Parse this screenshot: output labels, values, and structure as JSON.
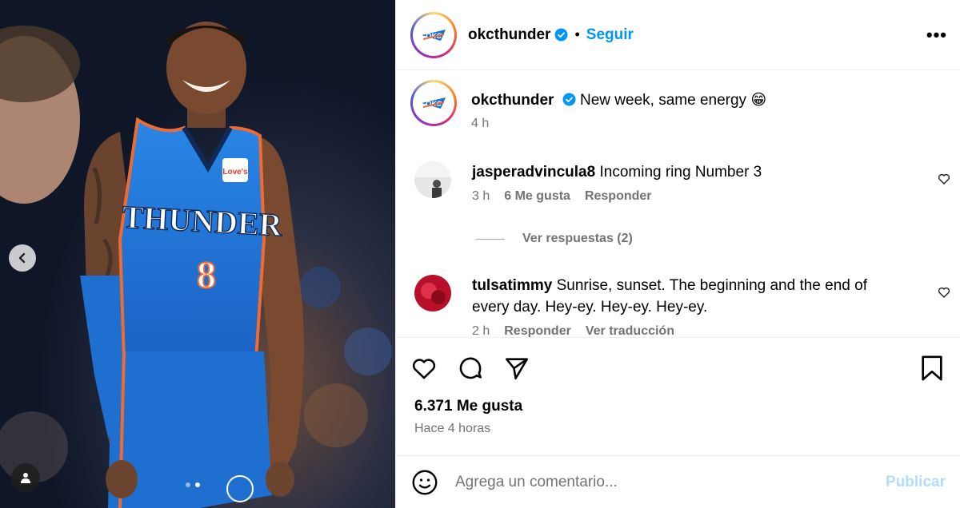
{
  "post": {
    "username": "okcthunder",
    "follow_label": "Seguir",
    "separator": "•",
    "more_label": "•••"
  },
  "caption": {
    "username": "okcthunder",
    "text": "New week, same energy 😁",
    "time": "4 h"
  },
  "comments": [
    {
      "username": "jasperadvincula8",
      "text": "Incoming ring Number 3",
      "time": "3 h",
      "likes": "6 Me gusta",
      "reply_label": "Responder"
    },
    {
      "username": "tulsatimmy",
      "text": "Sunrise, sunset. The beginning and the end of every day. Hey-ey. Hey-ey. Hey-ey.",
      "time": "2 h",
      "reply_label": "Responder",
      "translate_label": "Ver traducción"
    }
  ],
  "replies_label": "Ver respuestas (2)",
  "likes_count": "6.371 Me gusta",
  "posted_ago": "Hace 4 horas",
  "add_comment": {
    "placeholder": "Agrega un comentario...",
    "publish_label": "Publicar"
  },
  "media": {
    "jersey_text": "THUNDER",
    "jersey_number": "8",
    "patch_text": "Love's"
  },
  "colors": {
    "accent": "#0095f6",
    "thunder_blue": "#1e6fd0",
    "thunder_orange": "#ef6b32"
  },
  "icons": [
    "chevron-left-icon",
    "user-tag-icon",
    "verified-badge-icon",
    "heart-icon",
    "comment-icon",
    "share-icon",
    "bookmark-icon",
    "emoji-icon",
    "more-options-icon"
  ]
}
